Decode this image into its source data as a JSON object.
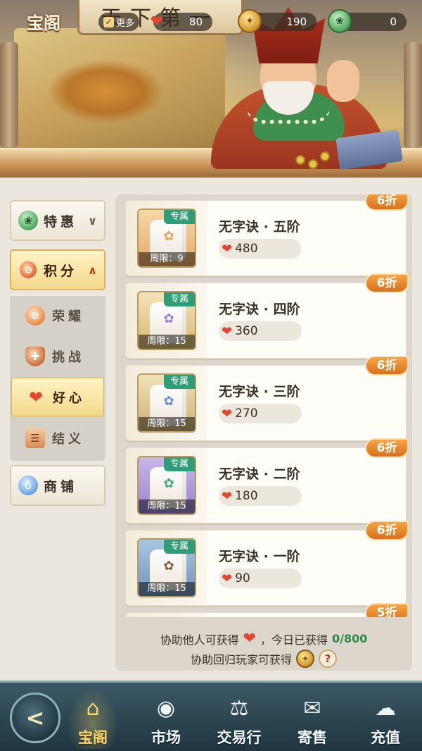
{
  "header": {
    "title": "宝阁",
    "sign_text": "天下第一商",
    "more_label": "更多",
    "resources": [
      {
        "icon": "heart-points-icon",
        "value": "80"
      },
      {
        "icon": "gold-coin-icon",
        "value": "190"
      },
      {
        "icon": "jade-coin-icon",
        "value": "0"
      }
    ]
  },
  "sidebar": {
    "main": [
      {
        "label": "特惠",
        "icon": "jade-icon",
        "caret": "∨"
      },
      {
        "label": "积分",
        "icon": "points-icon",
        "caret": "∧"
      },
      {
        "label": "商铺",
        "icon": "gourd-icon"
      }
    ],
    "sub": [
      {
        "label": "荣耀",
        "icon": "honor-icon"
      },
      {
        "label": "挑战",
        "icon": "shield-icon"
      },
      {
        "label": "好心",
        "icon": "heart-icon"
      },
      {
        "label": "结义",
        "icon": "scroll-icon"
      }
    ]
  },
  "items": [
    {
      "name": "无字诀 · 五阶",
      "price": "480",
      "discount": "6折",
      "tag": "专属",
      "limit": "周限：9",
      "color": "#f0a24a"
    },
    {
      "name": "无字诀 · 四阶",
      "price": "360",
      "discount": "6折",
      "tag": "专属",
      "limit": "周限：15",
      "color": "#9b7ad8"
    },
    {
      "name": "无字诀 · 三阶",
      "price": "270",
      "discount": "6折",
      "tag": "专属",
      "limit": "周限：15",
      "color": "#5f8ee0"
    },
    {
      "name": "无字诀 · 二阶",
      "price": "180",
      "discount": "6折",
      "tag": "专属",
      "limit": "周限：15",
      "color": "#3fa77e"
    },
    {
      "name": "无字诀 · 一阶",
      "price": "90",
      "discount": "6折",
      "tag": "专属",
      "limit": "周限：15",
      "color": "#8b5a3c"
    }
  ],
  "partial_discount": "5折",
  "footer": {
    "line1_prefix": "协助他人可获得",
    "line1_mid": "，今日已获得",
    "line1_count": "0/800",
    "line2": "协助回归玩家可获得",
    "help": "?"
  },
  "nav": {
    "back_icon": "back-arrow-icon",
    "items": [
      {
        "label": "宝阁",
        "icon": "pavilion-icon"
      },
      {
        "label": "市场",
        "icon": "coin-icon"
      },
      {
        "label": "交易行",
        "icon": "scale-icon"
      },
      {
        "label": "寄售",
        "icon": "consign-icon"
      },
      {
        "label": "充值",
        "icon": "cloud-icon"
      }
    ]
  },
  "colors": {
    "accent": "#e4452e",
    "discount": "#e6862c",
    "exclusive_tag": "#2f9d78",
    "nav_bg": "#2c4450"
  }
}
